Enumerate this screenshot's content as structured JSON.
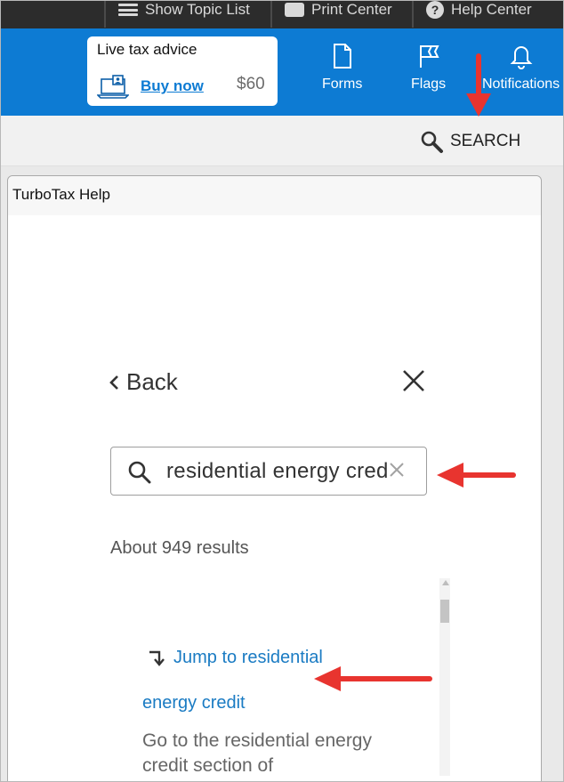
{
  "topbar": {
    "show_topic_list": "Show Topic List",
    "print_center": "Print Center",
    "help_center": "Help Center"
  },
  "header": {
    "advice": {
      "title": "Live tax advice",
      "buy_label": "Buy now",
      "price": "$60"
    },
    "forms_label": "Forms",
    "flags_label": "Flags",
    "notifications_label": "Notifications"
  },
  "search_bar": {
    "label": "SEARCH"
  },
  "help_window": {
    "tab_label": "TurboTax Help",
    "back_label": "Back",
    "search_value": "residential energy cred",
    "results_count": "About 949 results",
    "jump_label": "Jump to residential",
    "result_title": "energy credit",
    "result_snippet": "Go to the residential energy credit section of"
  },
  "colors": {
    "brand_blue": "#0d7bd3",
    "link_blue": "#1a7bc3",
    "annotation_red": "#e8342f",
    "topbar": "#2c2c2c"
  },
  "icons": [
    "list-icon",
    "print-icon",
    "help-icon",
    "laptop-advisor-icon",
    "forms-icon",
    "flag-icon",
    "bell-icon",
    "search-icon",
    "chevron-left-icon",
    "close-icon",
    "clear-icon",
    "jump-arrow-icon"
  ]
}
